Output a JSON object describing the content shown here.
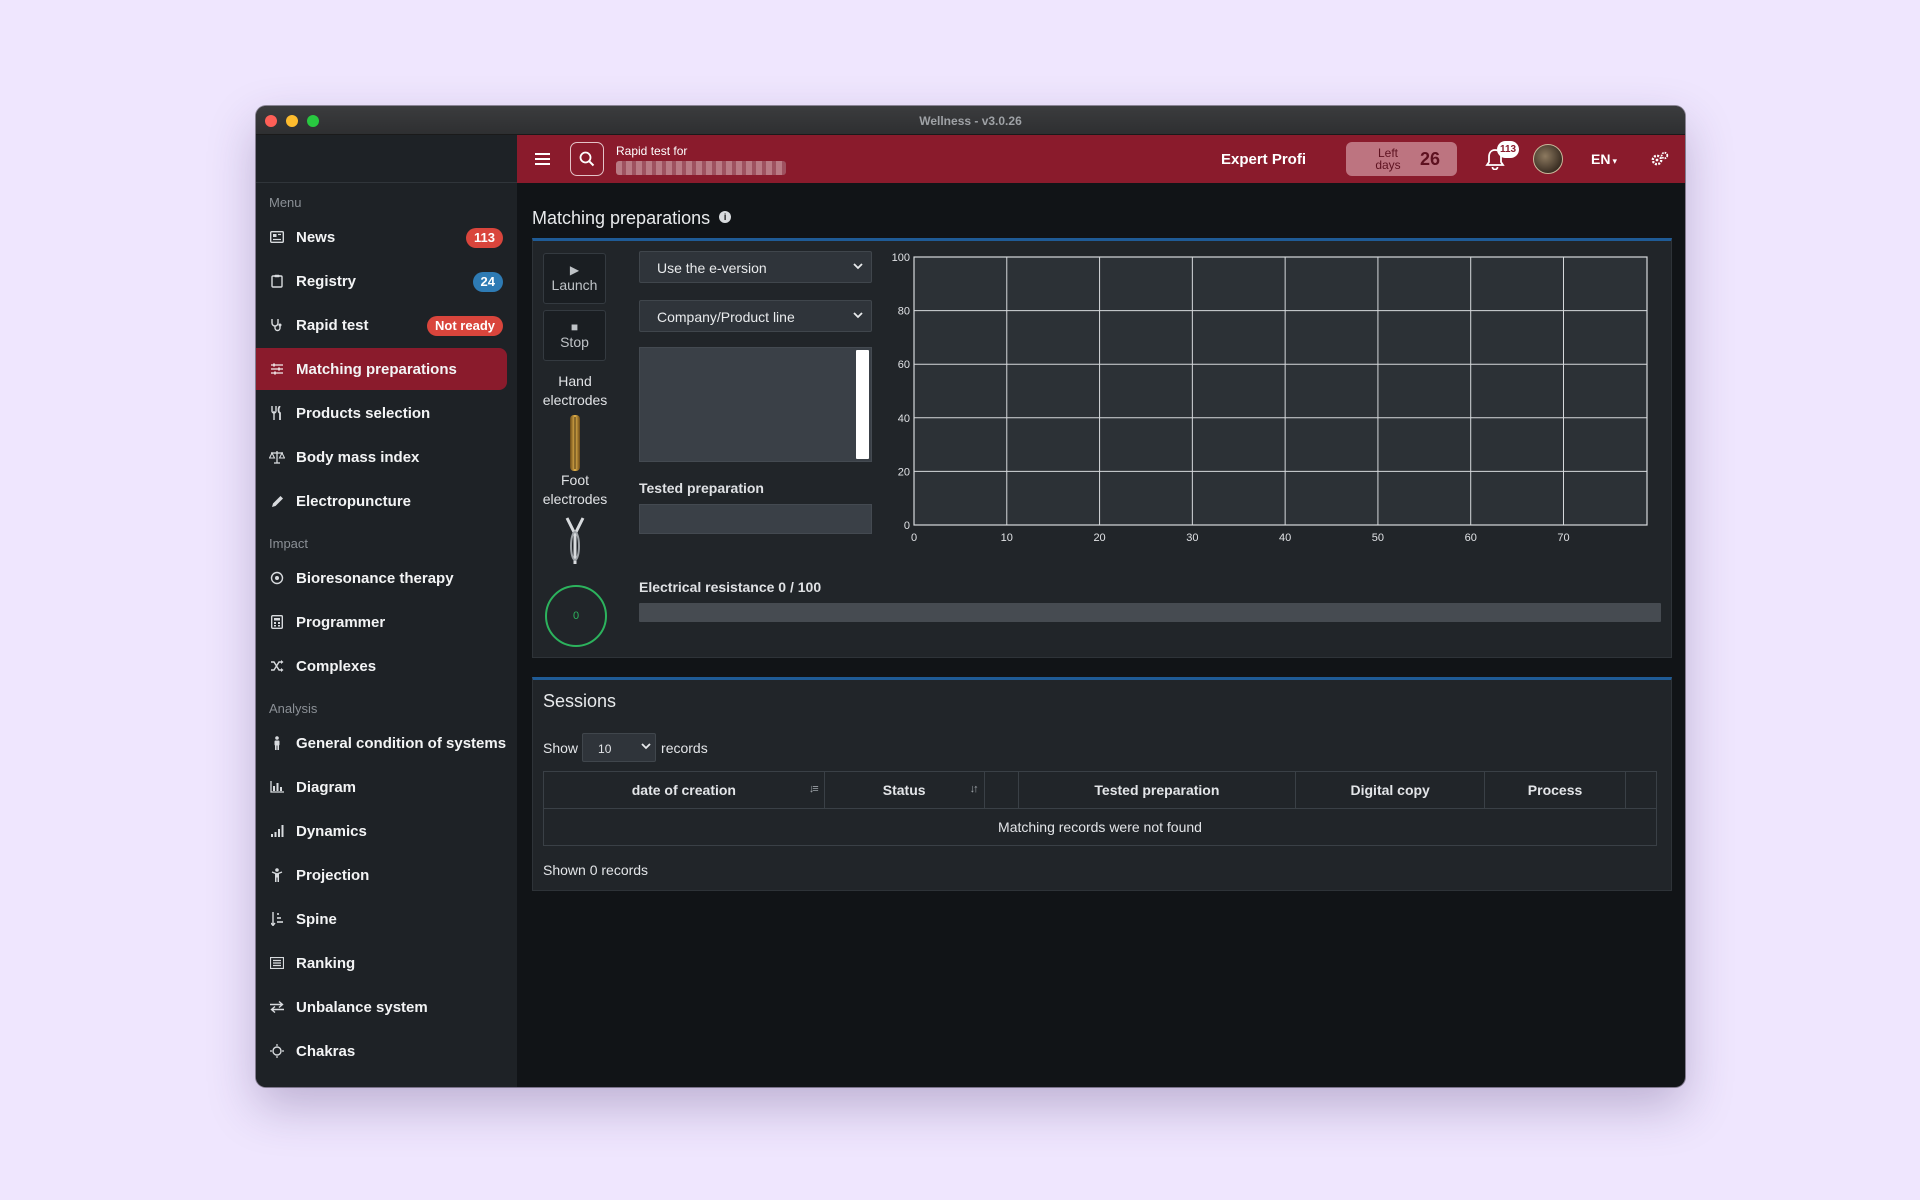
{
  "window": {
    "title": "Wellness - v3.0.26"
  },
  "sidebar": {
    "sections": [
      "Menu",
      "Impact",
      "Analysis"
    ],
    "menu_items": [
      {
        "label": "News",
        "icon": "newspaper-icon",
        "badge": "113",
        "badge_color": "#d9453c"
      },
      {
        "label": "Registry",
        "icon": "clipboard-icon",
        "badge": "24",
        "badge_color": "#2e7bb4"
      },
      {
        "label": "Rapid test",
        "icon": "stethoscope-icon",
        "badge": "Not ready",
        "badge_color": "#d9453c"
      },
      {
        "label": "Matching preparations",
        "icon": "sliders-icon",
        "active": true
      },
      {
        "label": "Products selection",
        "icon": "utensils-icon"
      },
      {
        "label": "Body mass index",
        "icon": "scale-icon"
      },
      {
        "label": "Electropuncture",
        "icon": "pencil-icon"
      }
    ],
    "impact_items": [
      {
        "label": "Bioresonance therapy",
        "icon": "target-icon"
      },
      {
        "label": "Programmer",
        "icon": "calculator-icon"
      },
      {
        "label": "Complexes",
        "icon": "shuffle-icon"
      }
    ],
    "analysis_items": [
      {
        "label": "General condition of systems",
        "icon": "person-icon"
      },
      {
        "label": "Diagram",
        "icon": "bar-chart-icon"
      },
      {
        "label": "Dynamics",
        "icon": "signal-icon"
      },
      {
        "label": "Projection",
        "icon": "child-icon"
      },
      {
        "label": "Spine",
        "icon": "sort-icon"
      },
      {
        "label": "Ranking",
        "icon": "list-icon"
      },
      {
        "label": "Unbalance system",
        "icon": "exchange-icon"
      },
      {
        "label": "Chakras",
        "icon": "sun-icon"
      }
    ]
  },
  "topbar": {
    "rapid_label": "Rapid test for",
    "user_type": "Expert Profi",
    "left_days_label": "Left days",
    "left_days_value": "26",
    "notifications": "113",
    "language": "EN"
  },
  "page": {
    "title": "Matching preparations"
  },
  "controls": {
    "launch": "Launch",
    "stop": "Stop",
    "hand_electrodes": "Hand electrodes",
    "foot_electrodes": "Foot electrodes",
    "meter_value": "0",
    "version_select": "Use the e-version",
    "company_select": "Company/Product line",
    "tested_preparation_label": "Tested preparation",
    "resistance_label": "Electrical resistance 0 / 100",
    "resistance_progress": 0
  },
  "chart_data": {
    "type": "line",
    "x": [],
    "series": [],
    "xlim": [
      0,
      79
    ],
    "ylim": [
      0,
      100
    ],
    "x_ticks": [
      0,
      10,
      20,
      30,
      40,
      50,
      60,
      70
    ],
    "y_ticks": [
      0,
      20,
      40,
      60,
      80,
      100
    ],
    "grid": true,
    "grid_color": "#d6d9dc",
    "background": "#2c3136"
  },
  "sessions": {
    "title": "Sessions",
    "show_label": "Show",
    "page_size": "10",
    "records_label": "records",
    "columns": [
      "date of creation",
      "Status",
      "",
      "Tested preparation",
      "Digital copy",
      "Process",
      ""
    ],
    "empty_message": "Matching records were not found",
    "footer": "Shown 0 records"
  }
}
